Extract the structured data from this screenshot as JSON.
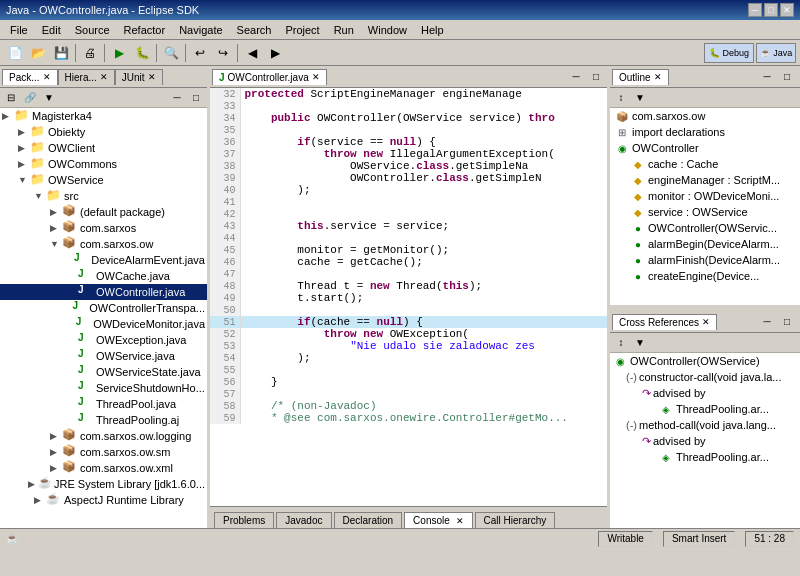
{
  "titleBar": {
    "title": "Java - OWController.java - Eclipse SDK",
    "buttons": [
      "─",
      "□",
      "✕"
    ]
  },
  "menuBar": {
    "items": [
      "File",
      "Edit",
      "Source",
      "Refactor",
      "Navigate",
      "Search",
      "Project",
      "Run",
      "Window",
      "Help"
    ]
  },
  "leftPanel": {
    "tabs": [
      "Pack...",
      "Hiera...",
      "JUnit"
    ],
    "activeTab": "Pack...",
    "tree": [
      {
        "indent": 0,
        "arrow": "▶",
        "icon": "📁",
        "label": "Magisterka4"
      },
      {
        "indent": 1,
        "arrow": "▶",
        "icon": "📁",
        "label": "Obiekty"
      },
      {
        "indent": 1,
        "arrow": "▶",
        "icon": "📁",
        "label": "OWClient"
      },
      {
        "indent": 1,
        "arrow": "▶",
        "icon": "📁",
        "label": "OWCommons"
      },
      {
        "indent": 1,
        "arrow": "▼",
        "icon": "📁",
        "label": "OWService"
      },
      {
        "indent": 2,
        "arrow": "▼",
        "icon": "📁",
        "label": "src"
      },
      {
        "indent": 3,
        "arrow": "▶",
        "icon": "📦",
        "label": "(default package)"
      },
      {
        "indent": 3,
        "arrow": "▶",
        "icon": "📦",
        "label": "com.sarxos"
      },
      {
        "indent": 3,
        "arrow": "▼",
        "icon": "📦",
        "label": "com.sarxos.ow"
      },
      {
        "indent": 4,
        "arrow": "",
        "icon": "J",
        "label": "DeviceAlarmEvent.java"
      },
      {
        "indent": 4,
        "arrow": "",
        "icon": "J",
        "label": "OWCache.java"
      },
      {
        "indent": 4,
        "arrow": "",
        "icon": "J",
        "label": "OWController.java",
        "selected": true
      },
      {
        "indent": 4,
        "arrow": "",
        "icon": "J",
        "label": "OWControllerTranspa..."
      },
      {
        "indent": 4,
        "arrow": "",
        "icon": "J",
        "label": "OWDeviceMonitor.java"
      },
      {
        "indent": 4,
        "arrow": "",
        "icon": "J",
        "label": "OWException.java"
      },
      {
        "indent": 4,
        "arrow": "",
        "icon": "J",
        "label": "OWService.java"
      },
      {
        "indent": 4,
        "arrow": "",
        "icon": "J",
        "label": "OWServiceState.java"
      },
      {
        "indent": 4,
        "arrow": "",
        "icon": "J",
        "label": "ServiceShutdownHo..."
      },
      {
        "indent": 4,
        "arrow": "",
        "icon": "J",
        "label": "ThreadPool.java"
      },
      {
        "indent": 4,
        "arrow": "",
        "icon": "J",
        "label": "ThreadPooling.aj"
      },
      {
        "indent": 3,
        "arrow": "▶",
        "icon": "📦",
        "label": "com.sarxos.ow.logging"
      },
      {
        "indent": 3,
        "arrow": "▶",
        "icon": "📦",
        "label": "com.sarxos.ow.sm"
      },
      {
        "indent": 3,
        "arrow": "▶",
        "icon": "📦",
        "label": "com.sarxos.ow.xml"
      },
      {
        "indent": 2,
        "arrow": "▶",
        "icon": "☕",
        "label": "JRE System Library [jdk1.6.0..."
      },
      {
        "indent": 2,
        "arrow": "▶",
        "icon": "☕",
        "label": "AspectJ Runtime Library"
      }
    ]
  },
  "editor": {
    "tab": "OWController.java",
    "lines": [
      {
        "num": 32,
        "code": "    <kw>protected</kw> ScriptEngineManager engineManage"
      },
      {
        "num": 33,
        "code": ""
      },
      {
        "num": 34,
        "code": "    <kw>public</kw> OWController(OWService service) <kw>thro</kw>"
      },
      {
        "num": 35,
        "code": ""
      },
      {
        "num": 36,
        "code": "        <kw>if</kw>(service == <kw>null</kw>) {"
      },
      {
        "num": 37,
        "code": "            <kw>throw</kw> <kw>new</kw> IllegalArgumentException("
      },
      {
        "num": 38,
        "code": "                OWService.<kw>class</kw>.getSimpleName"
      },
      {
        "num": 39,
        "code": "                OWController.<kw>class</kw>.getSimpleN"
      },
      {
        "num": 40,
        "code": "        };"
      },
      {
        "num": 41,
        "code": ""
      },
      {
        "num": 42,
        "code": ""
      },
      {
        "num": 43,
        "code": "        <kw>this</kw>.service = service;"
      },
      {
        "num": 44,
        "code": ""
      },
      {
        "num": 45,
        "code": "        monitor = getMonitor();"
      },
      {
        "num": 46,
        "code": "        cache = getCache();"
      },
      {
        "num": 47,
        "code": ""
      },
      {
        "num": 48,
        "code": "        Thread t = <kw>new</kw> Thread(<kw>this</kw>);"
      },
      {
        "num": 49,
        "code": "        t.start();"
      },
      {
        "num": 50,
        "code": ""
      },
      {
        "num": 51,
        "code": "        <kw>if</kw>(cache == <kw>null</kw>) {",
        "highlight": true
      },
      {
        "num": 52,
        "code": "            <kw>throw</kw> <kw>new</kw> OWException("
      },
      {
        "num": 53,
        "code": "                <str>\"Nie udalo sie zaladowac zes</str>"
      },
      {
        "num": 54,
        "code": "        );"
      },
      {
        "num": 55,
        "code": ""
      },
      {
        "num": 56,
        "code": "    }"
      },
      {
        "num": 57,
        "code": ""
      },
      {
        "num": 58,
        "code": "    <comment>/* (non-Javadoc)</comment>"
      },
      {
        "num": 59,
        "code": "    <comment>* @see com.sarxos.onewire.Controller#getMo...</comment>"
      }
    ]
  },
  "outline": {
    "title": "Outline",
    "items": [
      {
        "indent": 0,
        "icon": "pkg",
        "label": "com.sarxos.ow"
      },
      {
        "indent": 0,
        "icon": "imp",
        "label": "import declarations"
      },
      {
        "indent": 0,
        "icon": "cls",
        "label": "OWController"
      },
      {
        "indent": 1,
        "icon": "field",
        "label": "cache : Cache"
      },
      {
        "indent": 1,
        "icon": "field",
        "label": "engineManager : ScriptM..."
      },
      {
        "indent": 1,
        "icon": "field",
        "label": "monitor : OWDeviceMoni..."
      },
      {
        "indent": 1,
        "icon": "field",
        "label": "service : OWService"
      },
      {
        "indent": 1,
        "icon": "method",
        "label": "OWController(OWServic..."
      },
      {
        "indent": 1,
        "icon": "method",
        "label": "alarmBegin(DeviceAlarm..."
      },
      {
        "indent": 1,
        "icon": "method",
        "label": "alarmFinish(DeviceAlarm..."
      },
      {
        "indent": 1,
        "icon": "method",
        "label": "createEngine(Device..."
      }
    ]
  },
  "crossRef": {
    "title": "Cross References",
    "items": [
      {
        "indent": 0,
        "icon": "cls",
        "label": "OWController(OWService)"
      },
      {
        "indent": 1,
        "icon": "arrow",
        "label": "constructor-call(void java.la..."
      },
      {
        "indent": 2,
        "icon": "advised",
        "label": "advised by"
      },
      {
        "indent": 3,
        "icon": "aj",
        "label": "ThreadPooling.ar..."
      },
      {
        "indent": 1,
        "icon": "arrow",
        "label": "method-call(void java.lang..."
      },
      {
        "indent": 2,
        "icon": "advised",
        "label": "advised by"
      },
      {
        "indent": 3,
        "icon": "aj",
        "label": "ThreadPooling.ar..."
      }
    ]
  },
  "bottomTabs": {
    "tabs": [
      "Problems",
      "Javadoc",
      "Declaration",
      "Console",
      "Call Hierarchy"
    ],
    "activeTab": "Console"
  },
  "statusBar": {
    "writable": "Writable",
    "insert": "Smart Insert",
    "position": "51 : 28"
  },
  "icons": {
    "collapse": "◀",
    "expand": "▶",
    "minimize": "─",
    "maximize": "□",
    "close": "✕"
  }
}
